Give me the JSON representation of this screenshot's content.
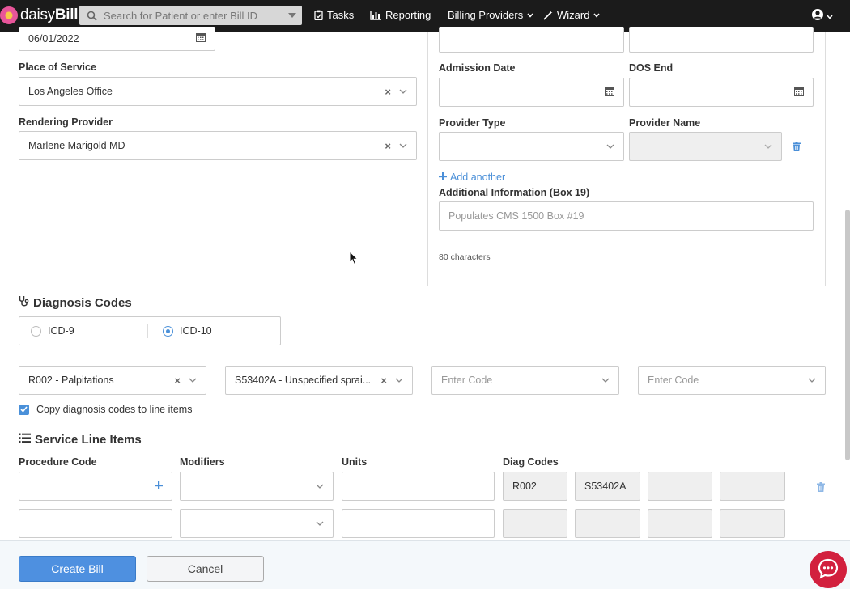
{
  "nav": {
    "brand_prefix": "daisy",
    "brand_suffix": "Bill",
    "search_placeholder": "Search for Patient or enter Bill ID",
    "tasks": "Tasks",
    "reporting": "Reporting",
    "billing_providers": "Billing Providers",
    "wizard": "Wizard"
  },
  "left": {
    "date_value": "06/01/2022",
    "place_of_service_label": "Place of Service",
    "place_of_service_value": "Los Angeles Office",
    "rendering_provider_label": "Rendering Provider",
    "rendering_provider_value": "Marlene Marigold MD"
  },
  "right": {
    "admission_date_label": "Admission Date",
    "dos_end_label": "DOS End",
    "provider_type_label": "Provider Type",
    "provider_name_label": "Provider Name",
    "add_another": "Add another",
    "additional_info_label": "Additional Information (Box 19)",
    "additional_info_placeholder": "Populates CMS 1500 Box #19",
    "char_count": "80 characters"
  },
  "diagnosis": {
    "title": "Diagnosis Codes",
    "icd9": "ICD-9",
    "icd10": "ICD-10",
    "selected": "ICD-10",
    "code1": "R002 - Palpitations",
    "code2": "S53402A - Unspecified sprai...",
    "code3_placeholder": "Enter Code",
    "code4_placeholder": "Enter Code",
    "copy_label": "Copy diagnosis codes to line items",
    "copy_checked": true
  },
  "service": {
    "title": "Service Line Items",
    "headers": {
      "procedure": "Procedure Code",
      "modifiers": "Modifiers",
      "units": "Units",
      "diag": "Diag Codes"
    },
    "row1_diag": [
      "R002",
      "S53402A",
      "",
      ""
    ],
    "row2_diag": [
      "",
      "",
      "",
      ""
    ]
  },
  "footer": {
    "create": "Create Bill",
    "cancel": "Cancel"
  },
  "colors": {
    "accent": "#4e90e0",
    "nav_bg": "#1b1b1b",
    "chat": "#d2203e"
  }
}
